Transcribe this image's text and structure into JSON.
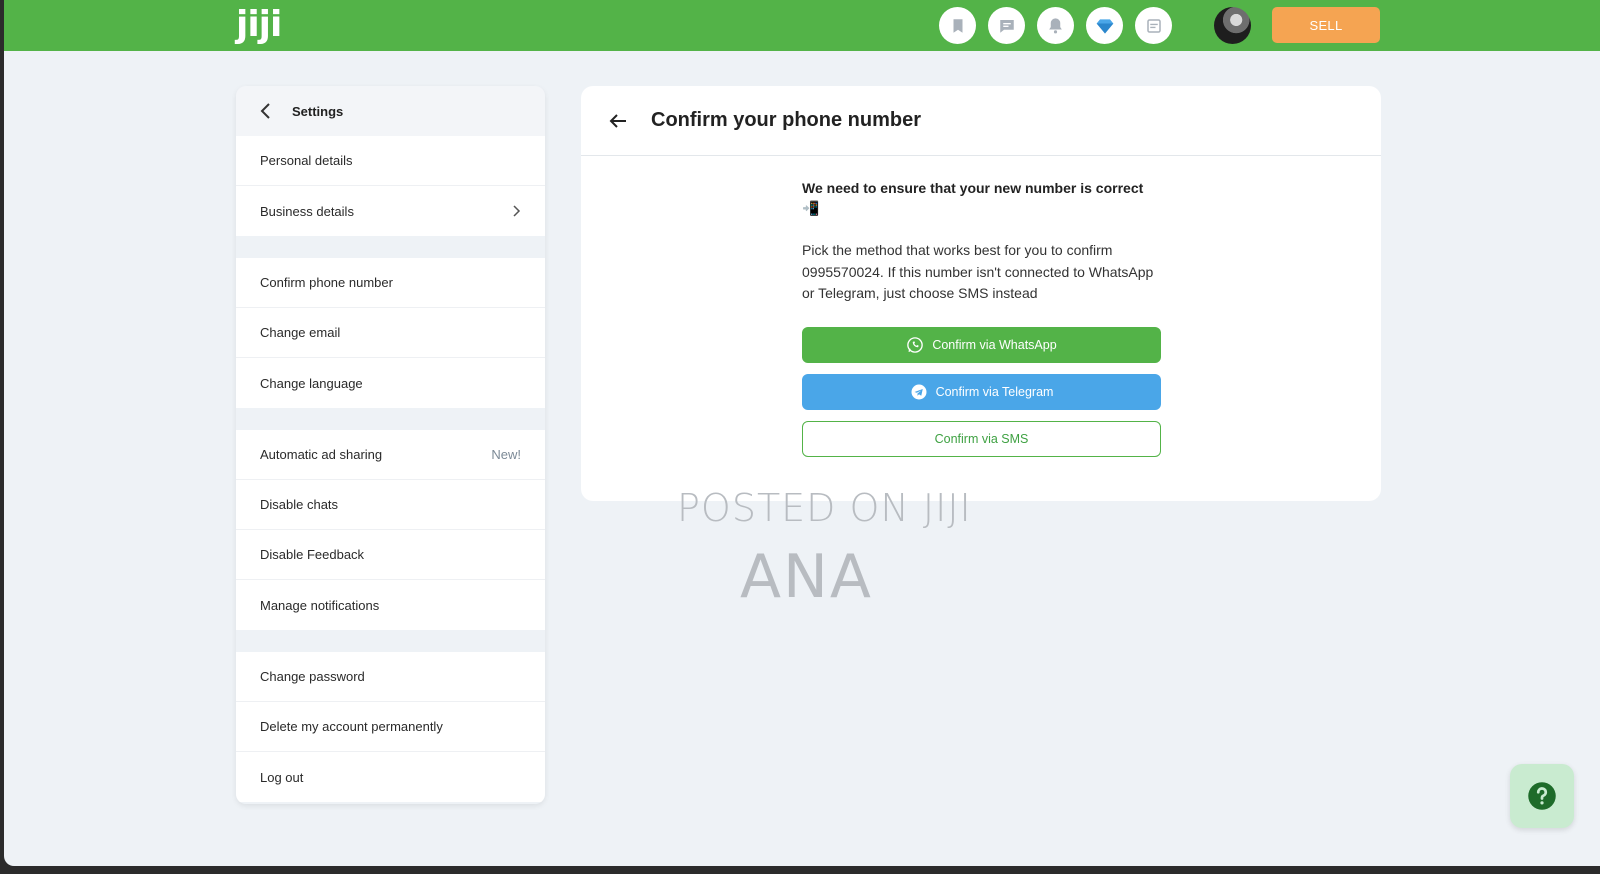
{
  "header": {
    "logo": "jiji",
    "icons": [
      "bookmark-icon",
      "chat-icon",
      "bell-icon",
      "diamond-icon",
      "adverts-icon"
    ],
    "sell_label": "SELL",
    "colors": {
      "bar": "#53b348",
      "sell": "#f5a452"
    }
  },
  "sidebar": {
    "title": "Settings",
    "groups": [
      [
        {
          "label": "Personal details"
        },
        {
          "label": "Business details",
          "chevron": true
        }
      ],
      [
        {
          "label": "Confirm phone number"
        },
        {
          "label": "Change email"
        },
        {
          "label": "Change language"
        }
      ],
      [
        {
          "label": "Automatic ad sharing",
          "badge": "New!"
        },
        {
          "label": "Disable chats"
        },
        {
          "label": "Disable Feedback"
        },
        {
          "label": "Manage notifications"
        }
      ],
      [
        {
          "label": "Change password"
        },
        {
          "label": "Delete my account permanently"
        },
        {
          "label": "Log out"
        }
      ]
    ]
  },
  "main": {
    "title": "Confirm your phone number",
    "lead": "We need to ensure that your new number is correct 📲",
    "description": "Pick the method that works best for you to confirm 0995570024. If this number isn't connected to WhatsApp or Telegram, just choose SMS instead",
    "buttons": {
      "whatsapp": "Confirm via WhatsApp",
      "telegram": "Confirm via Telegram",
      "sms": "Confirm via SMS"
    },
    "colors": {
      "whatsapp": "#53b348",
      "telegram": "#4aa6e8"
    }
  },
  "watermark": {
    "line1": "POSTED ON JIJI",
    "line2": "ANA"
  }
}
